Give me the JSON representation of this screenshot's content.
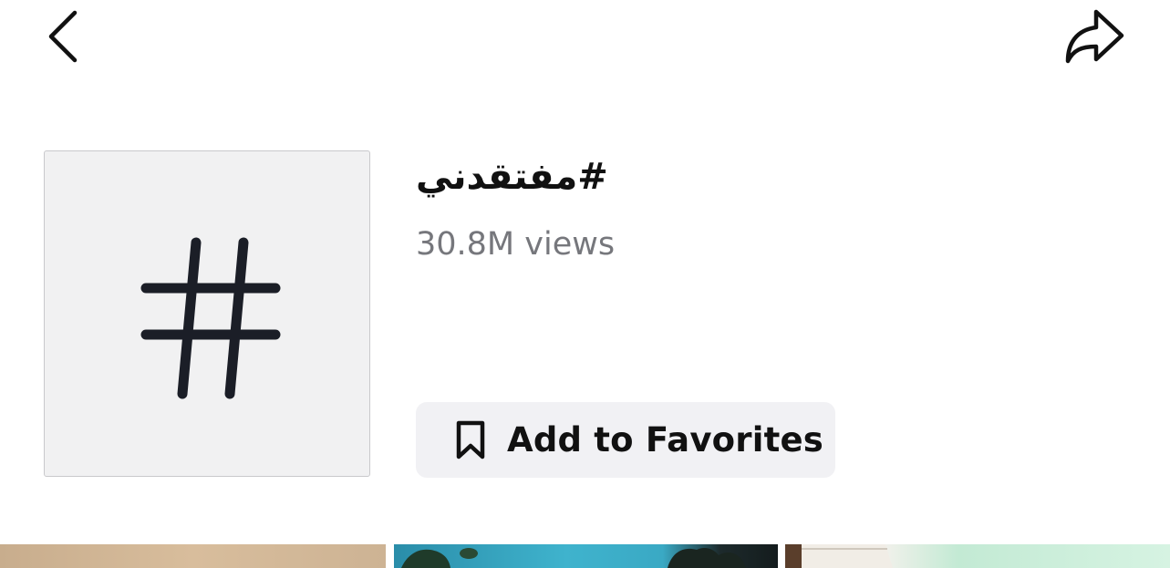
{
  "header": {
    "back_icon": "chevron-left-icon",
    "share_icon": "share-arrow-icon"
  },
  "hashtag": {
    "tile_icon": "hashtag-icon",
    "title": "#مفتقدني",
    "views": "30.8M views"
  },
  "favorites_button": {
    "icon": "bookmark-icon",
    "label": "Add to Favorites"
  },
  "video_grid": {
    "thumbnails": [
      {
        "label": "video thumbnail 1",
        "color": "#d1b697"
      },
      {
        "label": "video thumbnail 2",
        "color": "#35a5c1"
      },
      {
        "label": "video thumbnail 3",
        "color": "#cdeedb"
      }
    ]
  }
}
